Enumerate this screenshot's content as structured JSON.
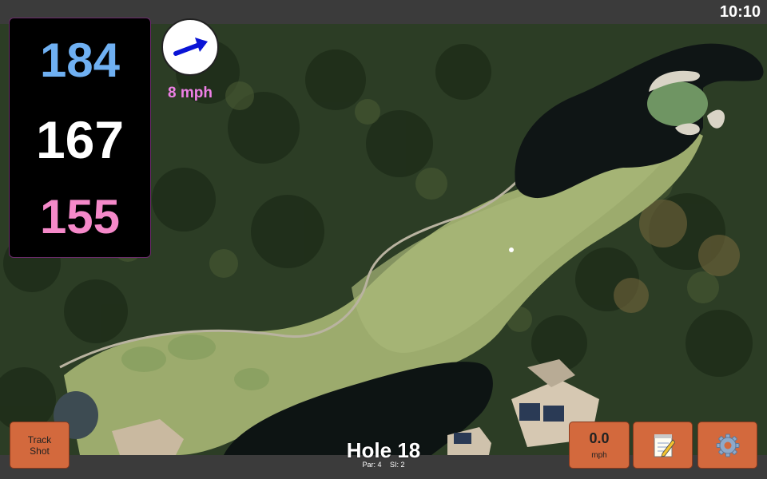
{
  "status_bar": {
    "time": "10:10"
  },
  "yardages": {
    "back": "184",
    "middle": "167",
    "front": "155"
  },
  "wind": {
    "speed": "8 mph",
    "direction_icon": "arrow-right-up-icon"
  },
  "hole": {
    "title": "Hole 18",
    "par": "Par: 4",
    "stroke_index": "SI: 2"
  },
  "buttons": {
    "track_shot_line1": "Track",
    "track_shot_line2": "Shot",
    "speed_value": "0.0",
    "speed_unit": "mph",
    "notes_icon": "notepad-icon",
    "settings_icon": "gear-icon"
  },
  "colors": {
    "back_yardage": "#6fb0f2",
    "middle_yardage": "#ffffff",
    "front_yardage": "#f589c9",
    "wind_text": "#ee80e6",
    "button_bg": "#d3693d"
  }
}
